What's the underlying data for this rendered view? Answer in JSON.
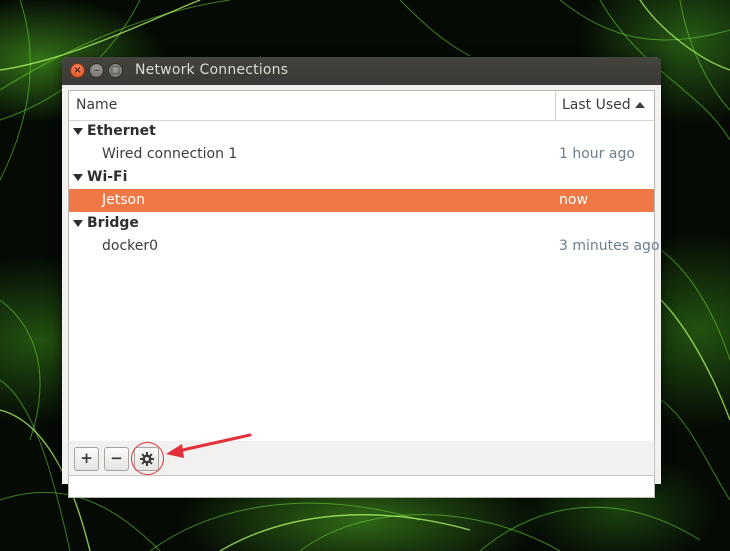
{
  "window": {
    "title": "Network Connections"
  },
  "columns": {
    "name": "Name",
    "last_used": "Last Used"
  },
  "groups": [
    {
      "label": "Ethernet",
      "connections": [
        {
          "name": "Wired connection 1",
          "last_used": "1 hour ago",
          "selected": false
        }
      ]
    },
    {
      "label": "Wi-Fi",
      "connections": [
        {
          "name": "Jetson",
          "last_used": "now",
          "selected": true
        }
      ]
    },
    {
      "label": "Bridge",
      "connections": [
        {
          "name": "docker0",
          "last_used": "3 minutes ago",
          "selected": false
        }
      ]
    }
  ],
  "toolbar": {
    "add_label": "+",
    "remove_label": "−"
  },
  "colors": {
    "selection": "#f07746",
    "annotation": "#e2303a"
  },
  "icons": {
    "edit": "gear-icon"
  }
}
